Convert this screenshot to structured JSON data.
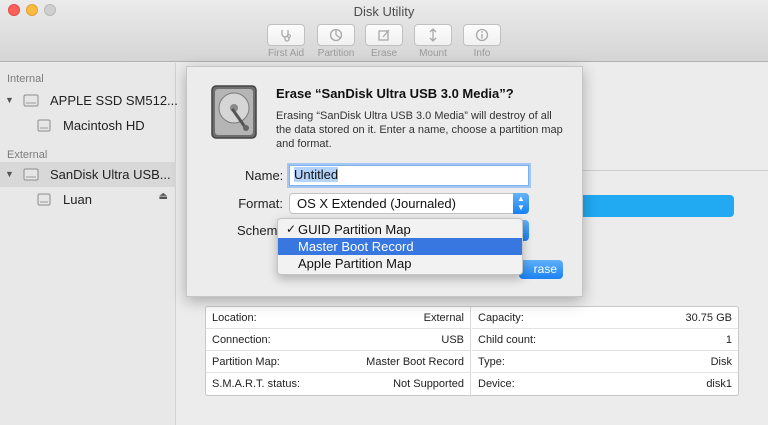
{
  "window": {
    "title": "Disk Utility"
  },
  "toolbar": [
    {
      "label": "First Aid",
      "icon": "stethoscope-icon"
    },
    {
      "label": "Partition",
      "icon": "partition-icon"
    },
    {
      "label": "Erase",
      "icon": "erase-icon"
    },
    {
      "label": "Mount",
      "icon": "mount-icon"
    },
    {
      "label": "Info",
      "icon": "info-icon"
    }
  ],
  "sidebar": {
    "internal_header": "Internal",
    "external_header": "External",
    "items": [
      {
        "label": "APPLE SSD SM512...",
        "icon": "internal-disk-icon"
      },
      {
        "label": "Macintosh HD",
        "icon": "volume-icon"
      },
      {
        "label": "SanDisk Ultra USB...",
        "icon": "external-disk-icon"
      },
      {
        "label": "Luan",
        "icon": "volume-icon"
      }
    ]
  },
  "dialog": {
    "title": "Erase “SanDisk Ultra USB 3.0 Media”?",
    "description": "Erasing “SanDisk Ultra USB 3.0 Media” will destroy of all the data stored on it. Enter a name, choose a partition map and format.",
    "name_label": "Name:",
    "name_value": "Untitled",
    "format_label": "Format:",
    "format_value": "OS X Extended (Journaled)",
    "scheme_label": "Scheme",
    "erase_label": "rase"
  },
  "scheme_menu": {
    "items": [
      {
        "label": "GUID Partition Map",
        "checked": true
      },
      {
        "label": "Master Boot Record",
        "highlighted": true
      },
      {
        "label": "Apple Partition Map"
      }
    ],
    "check_glyph": "✓"
  },
  "info": {
    "left": [
      {
        "key": "Location:",
        "value": "External"
      },
      {
        "key": "Connection:",
        "value": "USB"
      },
      {
        "key": "Partition Map:",
        "value": "Master Boot Record"
      },
      {
        "key": "S.M.A.R.T. status:",
        "value": "Not Supported"
      }
    ],
    "right": [
      {
        "key": "Capacity:",
        "value": "30.75 GB"
      },
      {
        "key": "Child count:",
        "value": "1"
      },
      {
        "key": "Type:",
        "value": "Disk"
      },
      {
        "key": "Device:",
        "value": "disk1"
      }
    ]
  },
  "colors": {
    "accent": "#1a82f3",
    "usage_bar": "#21a9f1",
    "menu_highlight": "#3876e0"
  }
}
